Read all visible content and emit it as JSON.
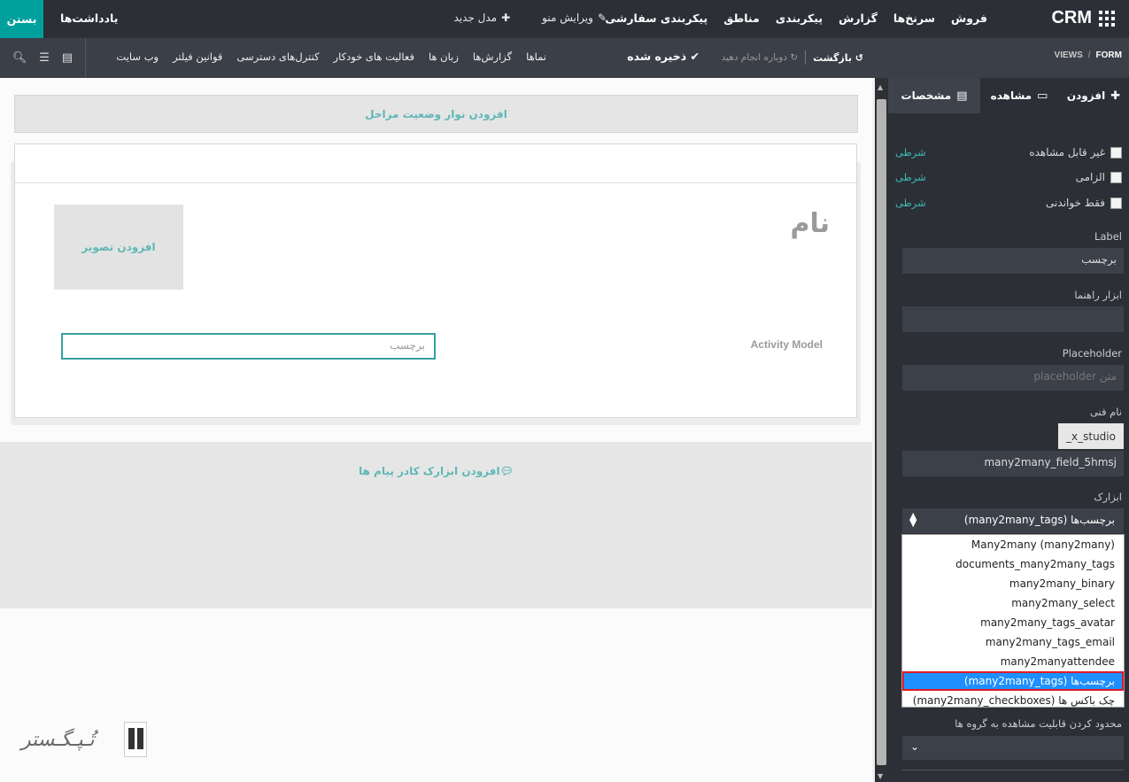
{
  "topbar": {
    "brand": "CRM",
    "menu": [
      "فروش",
      "سرنخ‌ها",
      "گزارش",
      "پیکربندی",
      "مناطق",
      "پیکربندی سفارشی"
    ],
    "edit_menu": "ویرایش منو",
    "new_model": "مدل جدید",
    "notes": "یادداشت‌ها",
    "close": "بستن"
  },
  "subbar": {
    "breadcrumb": [
      "VIEWS",
      "FORM"
    ],
    "back": "بازگشت",
    "redo": "دوباره انجام دهید",
    "saved": "ذخیره شده",
    "menu": [
      "نماها",
      "گزارش‌ها",
      "زبان ها",
      "فعالیت های خودکار",
      "کنترل‌های دسترسی",
      "قوانین فیلتر",
      "وب سایت"
    ]
  },
  "canvas": {
    "statusbar": "افزودن نوار وضعیت مراحل",
    "title": "نام",
    "add_image": "افزودن تصویر",
    "field_label": "Activity Model",
    "field_value": "برچسب",
    "chatter": "افزودن ابزارک کادر پیام ها",
    "logo": "تُـپـگـستر"
  },
  "sidebar": {
    "tabs": [
      "افزودن",
      "مشاهده",
      "مشخصات"
    ],
    "checkboxes": [
      {
        "label": "غیر قابل مشاهده",
        "cond": "شرطی"
      },
      {
        "label": "الزامی",
        "cond": "شرطی"
      },
      {
        "label": "فقط خواندنی",
        "cond": "شرطی"
      }
    ],
    "label_label": "Label",
    "label_value": "برچسب",
    "tooltip_label": "ابزار راهنما",
    "tooltip_value": "",
    "placeholder_label": "Placeholder",
    "placeholder_hint": "متن placeholder",
    "tech_label": "نام فنی",
    "tech_prefix": "_x_studio",
    "tech_value": "many2many_field_5hmsj",
    "widget_label": "ابزارک",
    "widget_selected": "برچسب‌ها (many2many_tags)",
    "widget_options": [
      "Many2many (many2many)",
      "documents_many2many_tags",
      "many2many_binary",
      "many2many_select",
      "many2many_tags_avatar",
      "many2many_tags_email",
      "many2manyattendee",
      "برچسب‌ها (many2many_tags)",
      "چک باکس ها (many2many_checkboxes)"
    ],
    "widget_selected_index": 7,
    "restrict_label": "محدود کردن قابلیت مشاهده به گروه ها",
    "colors": {
      "accent": "#00a09d",
      "selected": "#1e90ff",
      "highlight": "#e01b24"
    }
  }
}
